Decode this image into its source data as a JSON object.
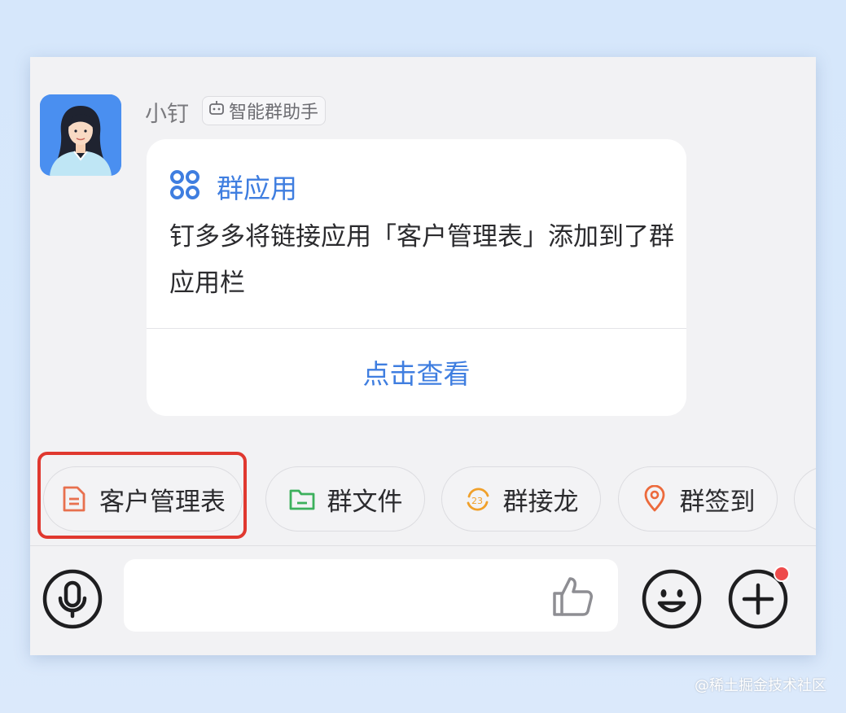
{
  "message": {
    "sender_name": "小钉",
    "sender_tag": "智能群助手",
    "card": {
      "title": "群应用",
      "body": "钉多多将链接应用「客户管理表」添加到了群应用栏",
      "action_label": "点击查看"
    }
  },
  "app_chips": [
    {
      "label": "客户管理表",
      "icon": "document-icon",
      "icon_color": "#e8704e",
      "highlighted": true
    },
    {
      "label": "群文件",
      "icon": "folder-icon",
      "icon_color": "#3cb05c"
    },
    {
      "label": "群接龙",
      "icon": "relay-icon",
      "icon_color": "#f0a02a"
    },
    {
      "label": "群签到",
      "icon": "location-pin-icon",
      "icon_color": "#ec6a3c"
    }
  ],
  "input_bar": {
    "voice_icon": "microphone-icon",
    "like_icon": "thumbs-up-icon",
    "emoji_icon": "smiley-icon",
    "more_icon": "plus-icon",
    "has_notification": true
  },
  "colors": {
    "accent": "#3f7ee0",
    "highlight_border": "#e0382f",
    "notification": "#ee4b4b"
  },
  "watermark": "@稀土掘金技术社区"
}
